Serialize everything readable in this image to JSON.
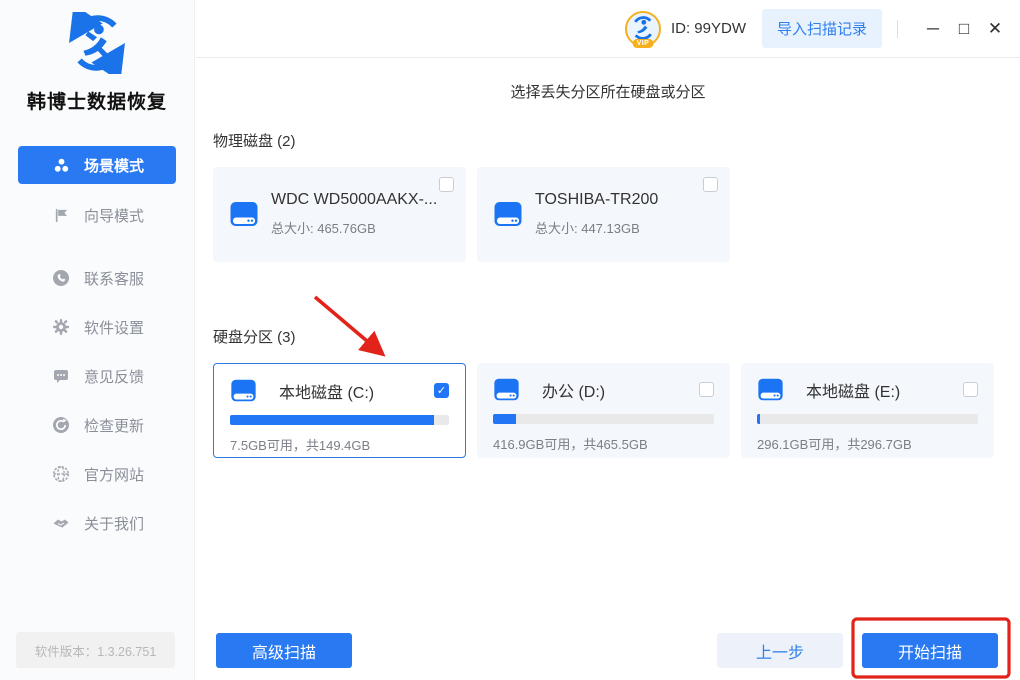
{
  "app": {
    "title": "韩博士数据恢复",
    "version": "软件版本：1.3.26.751"
  },
  "topbar": {
    "vip_badge": "VIP",
    "user_id": "ID: 99YDW",
    "import_button": "导入扫描记录"
  },
  "icons": {
    "check": "✓",
    "minimize": "─",
    "maximize": "□",
    "close": "✕"
  },
  "sidebar": {
    "items": [
      {
        "label": "场景模式"
      },
      {
        "label": "向导模式"
      },
      {
        "label": "联系客服"
      },
      {
        "label": "软件设置"
      },
      {
        "label": "意见反馈"
      },
      {
        "label": "检查更新"
      },
      {
        "label": "官方网站"
      },
      {
        "label": "关于我们"
      }
    ]
  },
  "main": {
    "title": "选择丢失分区所在硬盘或分区",
    "physical": {
      "header": "物理磁盘 (2)",
      "cards": [
        {
          "name": "WDC WD5000AAKX-...",
          "size": "总大小: 465.76GB",
          "checked": false
        },
        {
          "name": "TOSHIBA-TR200",
          "size": "总大小: 447.13GB",
          "checked": false
        }
      ]
    },
    "partitions": {
      "header": "硬盘分区 (3)",
      "cards": [
        {
          "name": "本地磁盘 (C:)",
          "info": "7.5GB可用，共149.4GB",
          "used_percent": 93,
          "checked": true,
          "selected": true
        },
        {
          "name": "办公 (D:)",
          "info": "416.9GB可用，共465.5GB",
          "used_percent": 10.5,
          "checked": false,
          "selected": false
        },
        {
          "name": "本地磁盘 (E:)",
          "info": "296.1GB可用，共296.7GB",
          "used_percent": 1.5,
          "checked": false,
          "selected": false
        }
      ]
    }
  },
  "footer": {
    "advanced_scan": "高级扫描",
    "prev_step": "上一步",
    "start_scan": "开始扫描"
  },
  "colors": {
    "primary_blue": "#2879f2",
    "progress_blue": "#2276f5",
    "annotation_red": "#e2231a",
    "card_bg": "#f4f7fb"
  }
}
